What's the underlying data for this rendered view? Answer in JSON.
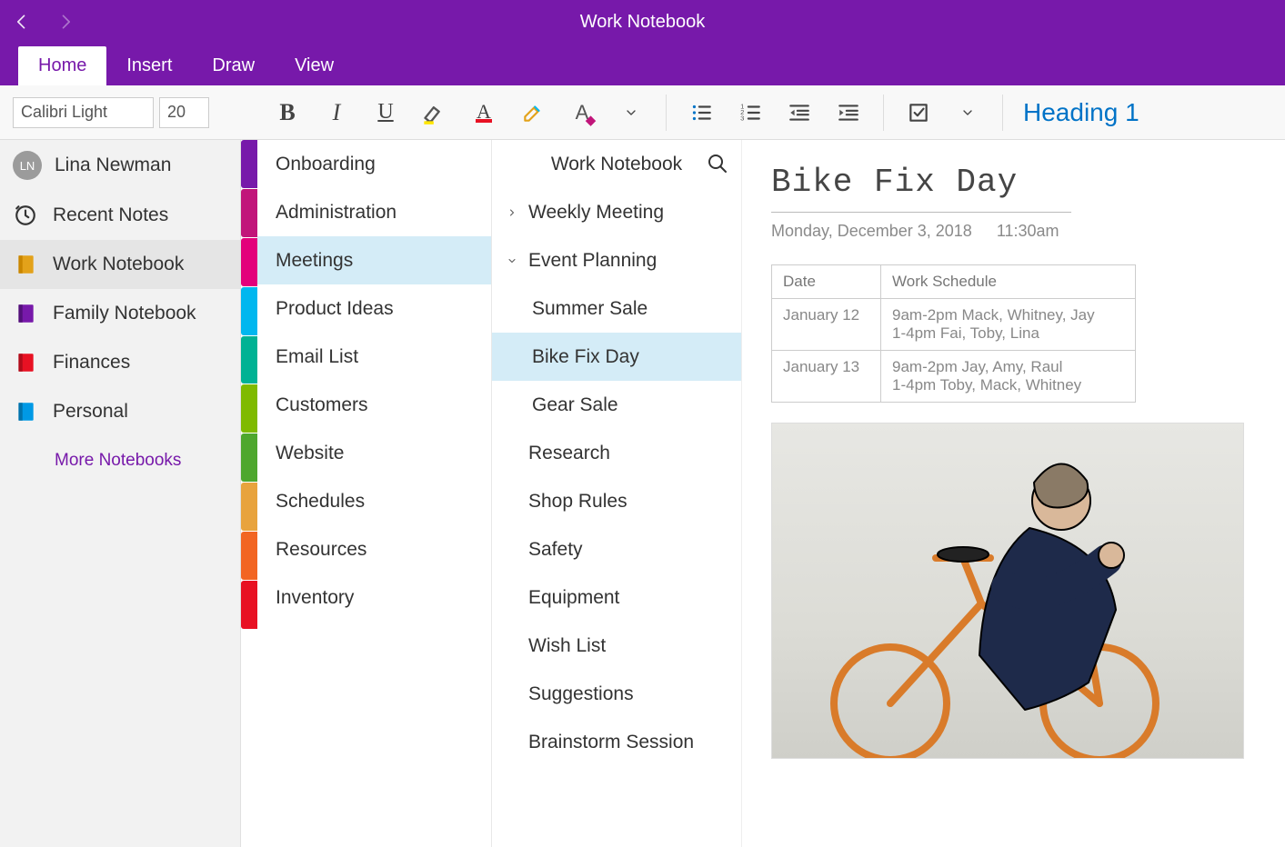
{
  "title": "Work Notebook",
  "tabs": [
    "Home",
    "Insert",
    "Draw",
    "View"
  ],
  "active_tab": 0,
  "ribbon": {
    "font_name": "Calibri Light",
    "font_size": "20",
    "style_label": "Heading 1"
  },
  "user": {
    "initials": "LN",
    "name": "Lina Newman"
  },
  "sidebar": {
    "items": [
      {
        "label": "Recent Notes",
        "icon": "clock"
      },
      {
        "label": "Work Notebook",
        "icon": "notebook",
        "color": "#e3a21a",
        "selected": true
      },
      {
        "label": "Family Notebook",
        "icon": "notebook",
        "color": "#7719aa"
      },
      {
        "label": "Finances",
        "icon": "notebook",
        "color": "#e81123"
      },
      {
        "label": "Personal",
        "icon": "notebook",
        "color": "#0099e5"
      }
    ],
    "more_label": "More Notebooks"
  },
  "section_colors": [
    "#7719aa",
    "#c1157a",
    "#e3007b",
    "#00b7ef",
    "#00b294",
    "#7fba00",
    "#4ea72e",
    "#e8a33d",
    "#f26522",
    "#e81123"
  ],
  "current_notebook_label": "Work Notebook",
  "sections": [
    "Onboarding",
    "Administration",
    "Meetings",
    "Product Ideas",
    "Email List",
    "Customers",
    "Website",
    "Schedules",
    "Resources",
    "Inventory"
  ],
  "selected_section": 2,
  "pages": [
    {
      "label": "Weekly Meeting",
      "expand": "right"
    },
    {
      "label": "Event Planning",
      "expand": "down"
    },
    {
      "label": "Summer Sale",
      "sub": true
    },
    {
      "label": "Bike Fix Day",
      "sub": true,
      "selected": true
    },
    {
      "label": "Gear Sale",
      "sub": true
    },
    {
      "label": "Research"
    },
    {
      "label": "Shop Rules"
    },
    {
      "label": "Safety"
    },
    {
      "label": "Equipment"
    },
    {
      "label": "Wish List"
    },
    {
      "label": "Suggestions"
    },
    {
      "label": "Brainstorm Session"
    }
  ],
  "page": {
    "title": "Bike Fix Day",
    "date": "Monday, December 3, 2018",
    "time": "11:30am",
    "table": {
      "headers": [
        "Date",
        "Work Schedule"
      ],
      "rows": [
        [
          "January 12",
          "9am-2pm Mack, Whitney, Jay\n1-4pm Fai, Toby, Lina"
        ],
        [
          "January 13",
          "9am-2pm Jay, Amy, Raul\n1-4pm Toby, Mack, Whitney"
        ]
      ]
    }
  }
}
